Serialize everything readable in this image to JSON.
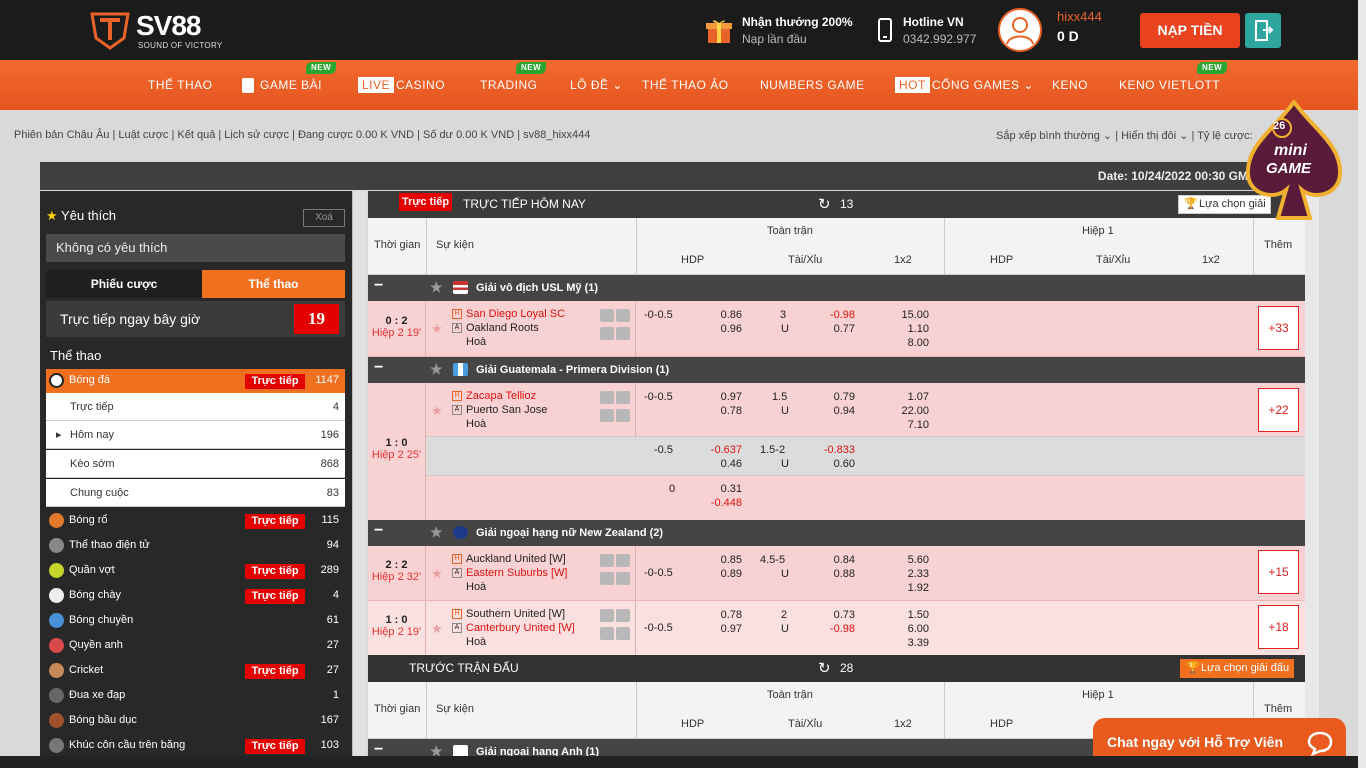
{
  "header": {
    "brand": "SV88",
    "tagline": "SOUND OF VICTORY",
    "reward_title": "Nhận thưởng 200%",
    "reward_sub": "Nạp lần đầu",
    "hotline_title": "Hotline VN",
    "hotline_number": "0342.992.977",
    "username": "hixx444",
    "balance": "0 D",
    "deposit_label": "NẠP TIỀN"
  },
  "nav": {
    "items": [
      {
        "label": "THỂ THAO"
      },
      {
        "label": "GAME BÀI",
        "badge": "NEW"
      },
      {
        "tag": "LIVE",
        "label": "CASINO"
      },
      {
        "label": "TRADING",
        "badge": "NEW"
      },
      {
        "label": "LÔ ĐỀ"
      },
      {
        "label": "THỂ THAO ẢO"
      },
      {
        "label": "NUMBERS GAME"
      },
      {
        "tag": "HOT",
        "label": "CỔNG GAMES"
      },
      {
        "label": "KENO"
      },
      {
        "label": "KENO VIETLOTT",
        "badge": "NEW"
      }
    ]
  },
  "subbar": {
    "left": "Phiên bản Châu Âu  |  Luật cược  |  Kết quả  |  Lịch sử cược  |  Đang cược 0.00 K VND  |  Số dư 0.00 K VND  |  sv88_hixx444",
    "right": "Sắp xếp bình thường ⌄  |  Hiển thị đôi ⌄  |  Tỷ lệ cược:"
  },
  "datebar": "Date: 10/24/2022 00:30 GMT Sport",
  "sidebar": {
    "favorites": "Yêu thích",
    "clear": "Xoá",
    "no_favorites": "Không có yêu thích",
    "tab_slip": "Phiếu cược",
    "tab_sport": "Thể thao",
    "live_now": "Trực tiếp ngay bây giờ",
    "live_count": "19",
    "sports_heading": "Thể thao",
    "live_label": "Trực tiếp",
    "football": {
      "name": "Bóng đá",
      "count": "1147"
    },
    "subs": [
      {
        "name": "Trực tiếp",
        "count": "4"
      },
      {
        "name": "Hôm nay",
        "count": "196"
      },
      {
        "name": "Kèo sớm",
        "count": "868"
      },
      {
        "name": "Chung cuộc",
        "count": "83"
      }
    ],
    "sports": [
      {
        "name": "Bóng rổ",
        "count": "115",
        "live": true,
        "color": "#e07a2a"
      },
      {
        "name": "Thể thao điện tử",
        "count": "94",
        "live": false,
        "color": "#888888"
      },
      {
        "name": "Quần vợt",
        "count": "289",
        "live": true,
        "color": "#c7d62a"
      },
      {
        "name": "Bóng chày",
        "count": "4",
        "live": true,
        "color": "#eeeeee"
      },
      {
        "name": "Bóng chuyền",
        "count": "61",
        "live": false,
        "color": "#4a90d9"
      },
      {
        "name": "Quyền anh",
        "count": "27",
        "live": false,
        "color": "#d94a4a"
      },
      {
        "name": "Cricket",
        "count": "27",
        "live": true,
        "color": "#c98a5a"
      },
      {
        "name": "Đua xe đạp",
        "count": "1",
        "live": false,
        "color": "#666666"
      },
      {
        "name": "Bóng bầu dục",
        "count": "167",
        "live": false,
        "color": "#a0522d"
      },
      {
        "name": "Khúc côn cầu trên băng",
        "count": "103",
        "live": true,
        "color": "#777777"
      }
    ]
  },
  "main": {
    "live_tag": "Trực tiếp",
    "live_title": "TRỰC TIẾP HÔM NAY",
    "live_count": "13",
    "select_league": "Lựa chọn giải",
    "select_league_full": "Lựa chọn giải đấu",
    "pre_title": "TRƯỚC TRẬN ĐẤU",
    "pre_count": "28",
    "cols": {
      "time": "Thời gian",
      "event": "Sự kiện",
      "full": "Toàn trận",
      "half": "Hiệp 1",
      "more": "Thêm",
      "hdp": "HDP",
      "ou": "Tài/Xỉu",
      "x12": "1x2"
    },
    "leagues": [
      {
        "name": "Giải vô địch USL Mỹ (1)"
      },
      {
        "name": "Giải Guatemala - Primera Division (1)"
      },
      {
        "name": "Giải ngoại hạng nữ New Zealand (2)"
      }
    ],
    "next_league": "Giải ngoại hạng Anh (1)",
    "matches": [
      {
        "score": "0 : 2",
        "time": "Hiệp 2 19'",
        "home": "San Diego Loyal SC",
        "away": "Oakland Roots",
        "draw": "Hoà",
        "hdp": "-0-0.5",
        "h1": "0.86",
        "h2": "0.96",
        "ou": "3",
        "ou_u": "U",
        "o1": "-0.98",
        "o2": "0.77",
        "x1": "15.00",
        "x2": "1.10",
        "x3": "8.00",
        "more": "+33"
      },
      {
        "score": "1 : 0",
        "time": "Hiệp 2 25'",
        "home": "Zacapa Tellioz",
        "away": "Puerto San Jose",
        "draw": "Hoà",
        "hdp": "-0-0.5",
        "h1": "0.97",
        "h2": "0.78",
        "ou": "1.5",
        "ou_u": "U",
        "o1": "0.79",
        "o2": "0.94",
        "x1": "1.07",
        "x2": "22.00",
        "x3": "7.10",
        "more": "+22",
        "alt1": {
          "hdp": "-0.5",
          "h1": "-0.637",
          "h2": "0.46",
          "ou": "1.5-2",
          "ou_u": "U",
          "o1": "-0.833",
          "o2": "0.60"
        },
        "alt2": {
          "hdp": "0",
          "h1": "0.31",
          "h2": "-0.448"
        }
      },
      {
        "score": "2 : 2",
        "time": "Hiệp 2 32'",
        "home": "Auckland United [W]",
        "away": "Eastern Suburbs [W]",
        "draw": "Hoà",
        "hdp": "-0-0.5",
        "h1": "0.85",
        "h2": "0.89",
        "ou": "4.5-5",
        "ou_u": "U",
        "o1": "0.84",
        "o2": "0.88",
        "x1": "5.60",
        "x2": "2.33",
        "x3": "1.92",
        "more": "+15"
      },
      {
        "score": "1 : 0",
        "time": "Hiệp 2 19'",
        "home": "Southern United [W]",
        "away": "Canterbury United [W]",
        "draw": "Hoà",
        "hdp": "-0-0.5",
        "h1": "0.78",
        "h2": "0.97",
        "ou": "2",
        "ou_u": "U",
        "o1": "0.73",
        "o2": "-0.98",
        "x1": "1.50",
        "x2": "6.00",
        "x3": "3.39",
        "more": "+18"
      }
    ]
  },
  "minigame": {
    "number": "26",
    "line1": "mini",
    "line2": "GAME"
  },
  "chat": "Chat ngay với Hỗ Trợ Viên"
}
